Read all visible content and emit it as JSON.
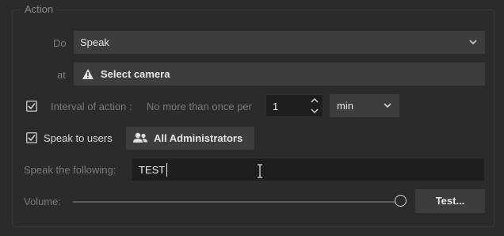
{
  "section": {
    "legend": "Action"
  },
  "do_row": {
    "label": "Do",
    "selected": "Speak",
    "chevron_icon": "chevron-down-icon"
  },
  "at_row": {
    "label": "at",
    "button_label": "Select camera",
    "icon": "warning-icon"
  },
  "interval": {
    "checked": true,
    "label": "Interval of action :",
    "prefix": "No more than once per",
    "value": "1",
    "unit": "min",
    "spin_up_icon": "chevron-up-icon",
    "spin_down_icon": "chevron-down-icon"
  },
  "speak_users": {
    "checked": true,
    "label": "Speak to users",
    "button_label": "All Administrators",
    "icon": "users-icon"
  },
  "speak_text": {
    "label": "Speak the following:",
    "value": "TEST"
  },
  "volume": {
    "label": "Volume:",
    "level": 1.0,
    "test_label": "Test..."
  }
}
